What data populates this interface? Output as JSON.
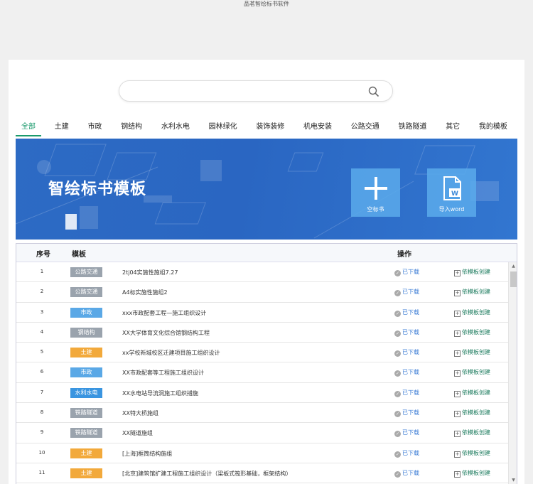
{
  "window": {
    "title": "品茗智绘标书软件"
  },
  "search": {
    "placeholder": ""
  },
  "tabs": [
    {
      "label": "全部",
      "active": true
    },
    {
      "label": "土建"
    },
    {
      "label": "市政"
    },
    {
      "label": "钢结构"
    },
    {
      "label": "水利水电"
    },
    {
      "label": "园林绿化"
    },
    {
      "label": "装饰装修"
    },
    {
      "label": "机电安装"
    },
    {
      "label": "公路交通"
    },
    {
      "label": "铁路隧道"
    },
    {
      "label": "其它"
    },
    {
      "label": "我的模板"
    }
  ],
  "banner": {
    "title": "智绘标书模板",
    "blank_label": "空标书",
    "import_label": "导入word"
  },
  "table": {
    "headers": {
      "index": "序号",
      "template": "模板",
      "action": "操作"
    },
    "download_label": "已下载",
    "create_label": "依模板创建",
    "rows": [
      {
        "index": "1",
        "tag": "公路交通",
        "color": "#9aa3ad",
        "name": "2tj04实施性施组7.27"
      },
      {
        "index": "2",
        "tag": "公路交通",
        "color": "#9aa3ad",
        "name": "A4标实施性施组2"
      },
      {
        "index": "3",
        "tag": "市政",
        "color": "#5aa8e6",
        "name": "xxx市政配套工程—施工组织设计"
      },
      {
        "index": "4",
        "tag": "钢结构",
        "color": "#9aa3ad",
        "name": "XX大学体育文化综合馆钢结构工程"
      },
      {
        "index": "5",
        "tag": "土建",
        "color": "#f2a93b",
        "name": "xx学校新城校区迁建项目施工组织设计"
      },
      {
        "index": "6",
        "tag": "市政",
        "color": "#5aa8e6",
        "name": "XX市政配套等工程施工组织设计"
      },
      {
        "index": "7",
        "tag": "水利水电",
        "color": "#3a95e0",
        "name": "XX水电站导流洞施工组织措施"
      },
      {
        "index": "8",
        "tag": "铁路隧道",
        "color": "#9aa3ad",
        "name": "XX特大桥施组"
      },
      {
        "index": "9",
        "tag": "铁路隧道",
        "color": "#9aa3ad",
        "name": "XX隧道施组"
      },
      {
        "index": "10",
        "tag": "土建",
        "color": "#f2a93b",
        "name": "[上海]框筒结构施组"
      },
      {
        "index": "11",
        "tag": "土建",
        "color": "#f2a93b",
        "name": "[北京]建筑馆扩建工程施工组织设计（梁板式筏形基础，框架结构）"
      }
    ]
  },
  "icons": {
    "search": "search-icon",
    "plus": "plus-icon",
    "word": "word-doc-icon",
    "check": "check-circle-icon",
    "create": "create-plus-icon"
  }
}
